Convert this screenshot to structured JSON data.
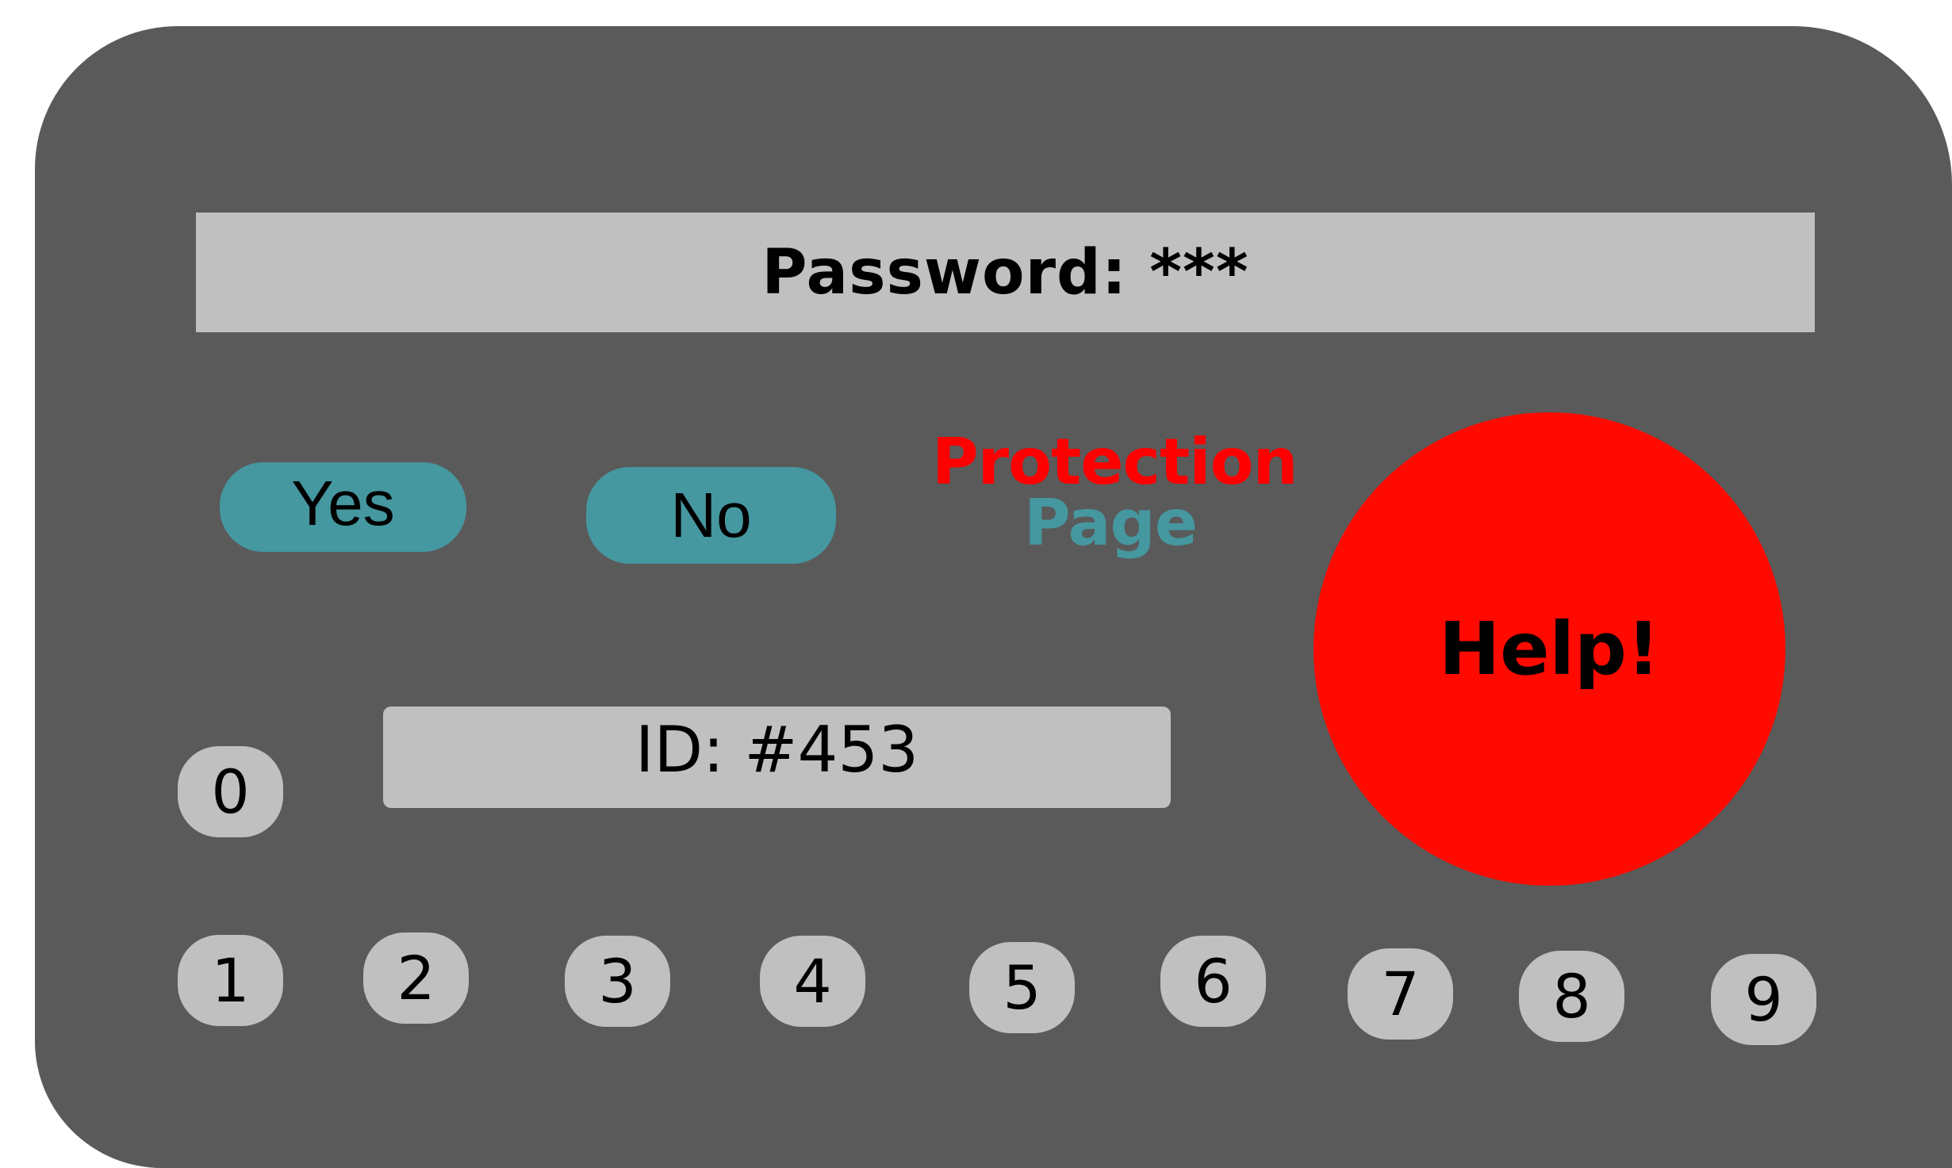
{
  "password_field": {
    "label": "Password:",
    "masked_value": "***"
  },
  "buttons": {
    "yes_label": "Yes",
    "no_label": "No",
    "help_label": "Help!"
  },
  "protection_label": {
    "line1": "Protection",
    "line2": "Page"
  },
  "id_display": {
    "text": "ID: #453"
  },
  "keypad": {
    "keys": [
      "0",
      "1",
      "2",
      "3",
      "4",
      "5",
      "6",
      "7",
      "8",
      "9"
    ]
  },
  "colors": {
    "device_body": "#5a5a5a",
    "panel_gray": "#c0c0c0",
    "teal_accent": "#4597a0",
    "help_red": "#ff0a00",
    "protection_red": "#ff0000"
  }
}
